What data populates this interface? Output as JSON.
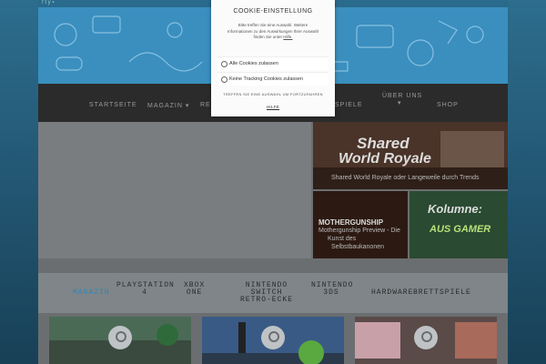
{
  "modal": {
    "title": "COOKIE-EINSTELLUNG",
    "description_1": "Bitte treffen Sie eine Auswahl. Weitere",
    "description_2": "Informationen zu den Auswirkungen Ihrer Auswahl",
    "description_3": "finden Sie unter",
    "description_link": "Hilfe.",
    "options": [
      {
        "label": "Alle Cookies zulassen"
      },
      {
        "label": "Keine Tracking Cookies zulassen"
      }
    ],
    "note": "TREFFEN SIE EINE AUSWAHL UM FORTZUFAHREN",
    "help": "HILFE"
  },
  "nav": {
    "items": [
      "STARTSEITE",
      "MAGAZIN",
      "RE",
      "SPIELE",
      "ÜBER UNS",
      "SHOP"
    ]
  },
  "hero": {
    "title_1": "Shared",
    "title_2": "World Royale",
    "subtitle": "Shared World Royale oder Langeweile durch Trends"
  },
  "tile1": {
    "title": "MOTHERGUNSHIP",
    "sub_1": "Mothergunship Preview - Die",
    "sub_2": "Kunst des",
    "sub_3": "Selbstbaukanonen"
  },
  "tile2": {
    "title_1": "Kolumne:",
    "title_2": "AUS GAMER"
  },
  "categories": [
    {
      "line1": "MAGAZIN",
      "line2": "",
      "line3": "",
      "active": true
    },
    {
      "line1": "PLAYSTATION",
      "line2": "4",
      "line3": "",
      "active": false
    },
    {
      "line1": "XBOX",
      "line2": "ONE",
      "line3": "",
      "active": false
    },
    {
      "line1": "NINTENDO",
      "line2": "SWITCH",
      "line3": "RETRO-ECKE",
      "active": false
    },
    {
      "line1": "NINTENDO",
      "line2": "3DS",
      "line3": "",
      "active": false
    },
    {
      "line1": "HARDWARE",
      "line2": "",
      "line3": "",
      "active": false
    },
    {
      "line1": "BRETTSPIELE",
      "line2": "",
      "line3": "",
      "active": false
    }
  ],
  "colors": {
    "accent": "#2f87b8",
    "nav_bg": "#2b2b2b",
    "banner": "#3a8fbf"
  }
}
